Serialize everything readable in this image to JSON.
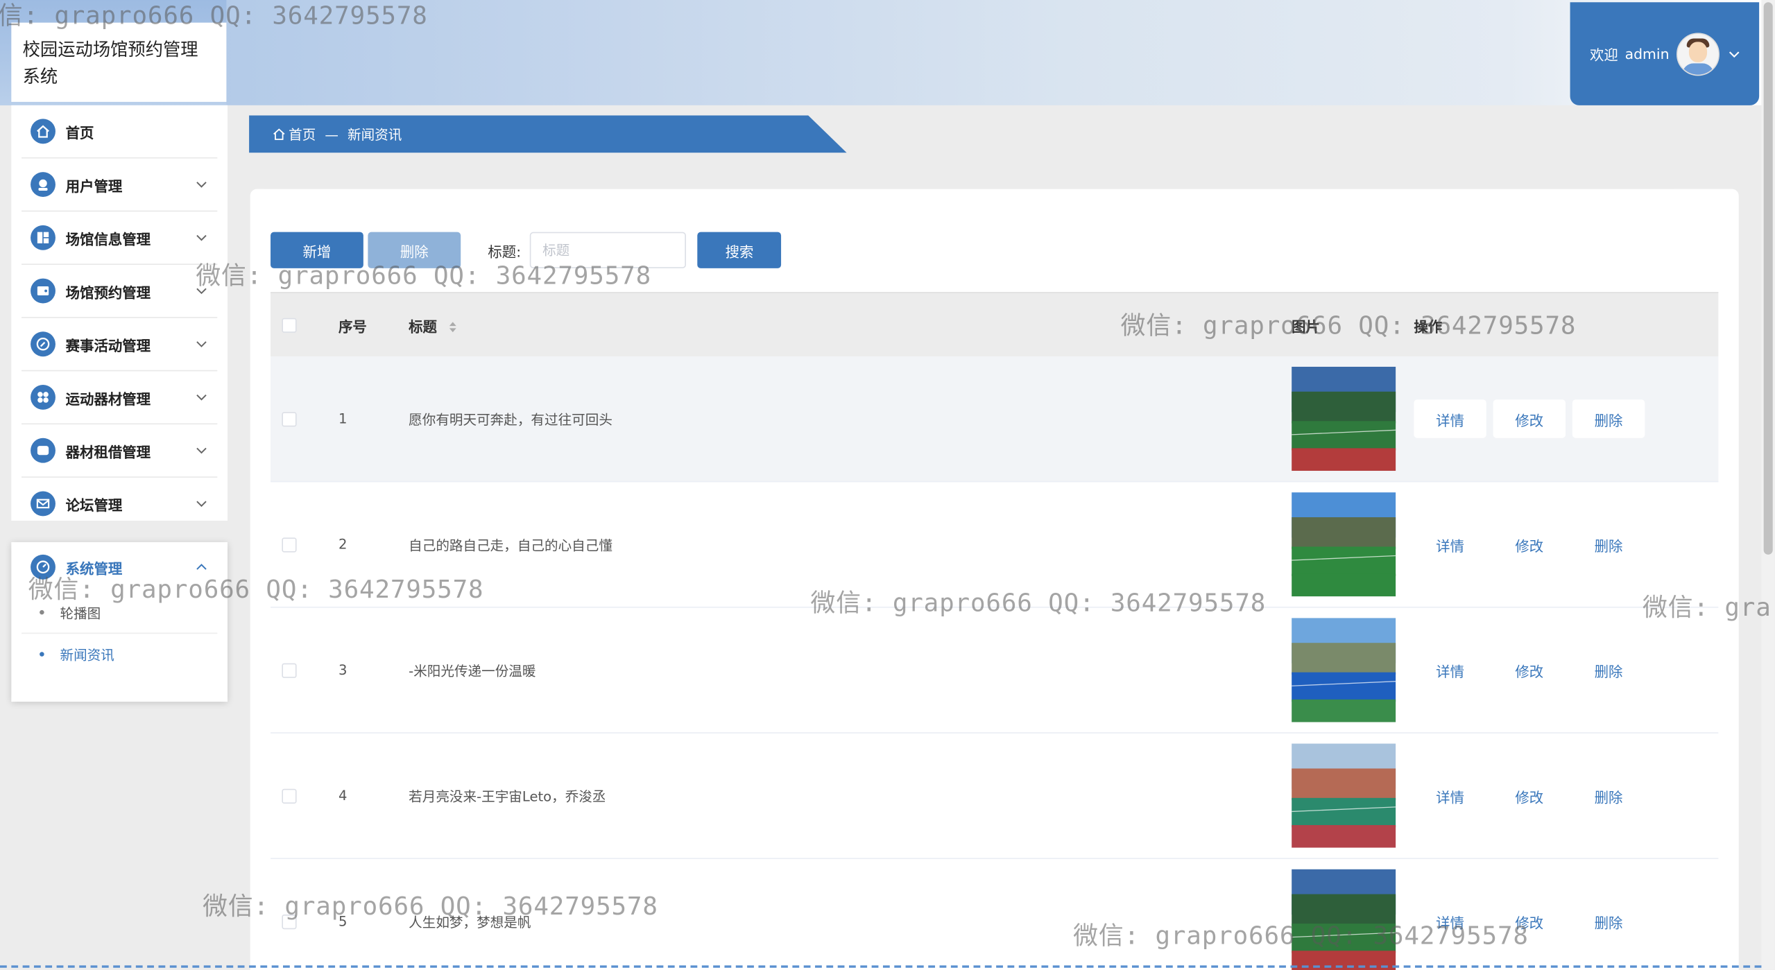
{
  "app": {
    "title": "校园运动场馆预约管理系统"
  },
  "header": {
    "welcome": "欢迎",
    "username": "admin",
    "avatar_icon": "user-avatar",
    "caret_icon": "chevron-down-icon"
  },
  "sidebar": {
    "items": [
      {
        "label": "首页",
        "icon": "home-icon",
        "expandable": false
      },
      {
        "label": "用户管理",
        "icon": "user-icon",
        "expandable": true
      },
      {
        "label": "场馆信息管理",
        "icon": "grid-icon",
        "expandable": true
      },
      {
        "label": "场馆预约管理",
        "icon": "wallet-icon",
        "expandable": true
      },
      {
        "label": "赛事活动管理",
        "icon": "compass-icon",
        "expandable": true
      },
      {
        "label": "运动器材管理",
        "icon": "apps-icon",
        "expandable": true
      },
      {
        "label": "器材租借管理",
        "icon": "card-icon",
        "expandable": true
      },
      {
        "label": "论坛管理",
        "icon": "mail-icon",
        "expandable": true
      }
    ],
    "system": {
      "label": "系统管理",
      "icon": "gauge-icon",
      "expanded": true,
      "subitems": [
        {
          "label": "轮播图",
          "active": false
        },
        {
          "label": "新闻资讯",
          "active": true
        }
      ]
    }
  },
  "breadcrumb": {
    "home": "首页",
    "separator": "—",
    "current": "新闻资讯"
  },
  "toolbar": {
    "add_label": "新增",
    "delete_label": "删除",
    "title_label": "标题:",
    "title_placeholder": "标题",
    "search_label": "搜索"
  },
  "table": {
    "headers": {
      "index": "序号",
      "title": "标题",
      "image": "图片",
      "ops": "操作"
    },
    "ops": {
      "detail": "详情",
      "edit": "修改",
      "delete": "删除"
    },
    "rows": [
      {
        "index": "1",
        "title": "愿你有明天可奔赴，有过往可回头",
        "image": "sports-field-photo-1"
      },
      {
        "index": "2",
        "title": "自己的路自己走，自己的心自己懂",
        "image": "sports-field-photo-2"
      },
      {
        "index": "3",
        "title": "-米阳光传递一份温暖",
        "image": "sports-field-photo-3"
      },
      {
        "index": "4",
        "title": "若月亮没来-王宇宙Leto，乔浚丞",
        "image": "sports-field-photo-4"
      },
      {
        "index": "5",
        "title": "人生如梦，梦想是帆",
        "image": "sports-field-photo-5"
      }
    ]
  },
  "watermark": {
    "text": "微信: grapro666 QQ: 3642795578",
    "partial_text": "微信: gra",
    "partial_top_text": "信: grapro666 QQ: 3642795578"
  },
  "colors": {
    "primary": "#3a77bb",
    "primary_disabled": "#8fb2d9",
    "background": "#ececec"
  }
}
